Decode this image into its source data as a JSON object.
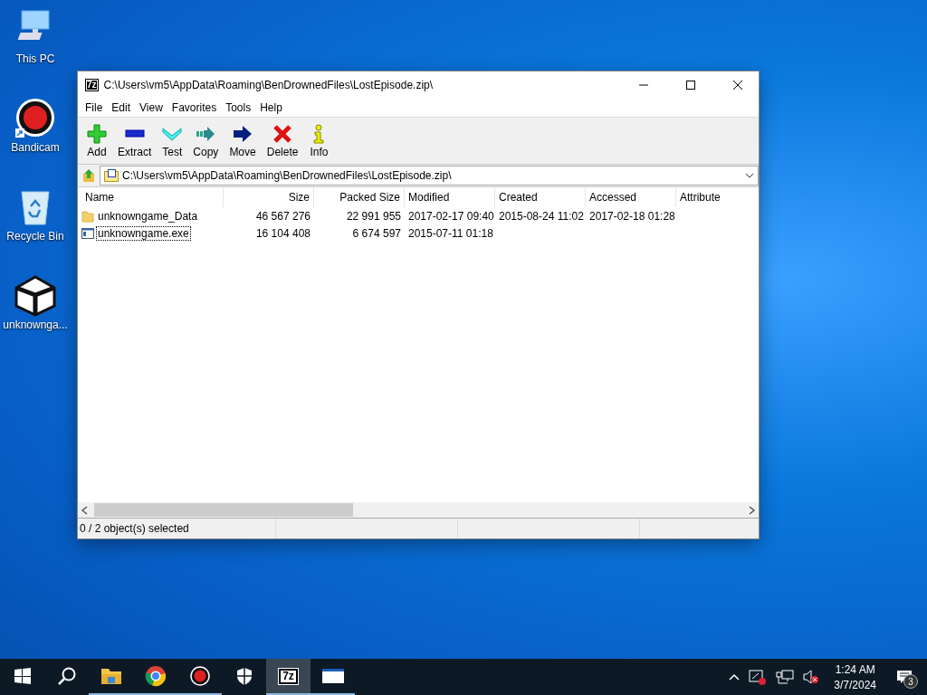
{
  "desktop_icons": [
    {
      "label": "This PC"
    },
    {
      "label": "Bandicam"
    },
    {
      "label": "Recycle Bin"
    },
    {
      "label": "unknownga..."
    }
  ],
  "window": {
    "app_icon_label": "7z",
    "title": "C:\\Users\\vm5\\AppData\\Roaming\\BenDrownedFiles\\LostEpisode.zip\\",
    "menu": [
      "File",
      "Edit",
      "View",
      "Favorites",
      "Tools",
      "Help"
    ],
    "toolbar": [
      {
        "label": "Add"
      },
      {
        "label": "Extract"
      },
      {
        "label": "Test"
      },
      {
        "label": "Copy"
      },
      {
        "label": "Move"
      },
      {
        "label": "Delete"
      },
      {
        "label": "Info"
      }
    ],
    "address": "C:\\Users\\vm5\\AppData\\Roaming\\BenDrownedFiles\\LostEpisode.zip\\",
    "columns": [
      "Name",
      "Size",
      "Packed Size",
      "Modified",
      "Created",
      "Accessed",
      "Attribute"
    ],
    "rows": [
      {
        "kind": "folder",
        "focused": false,
        "cells": [
          "unknowngame_Data",
          "46 567 276",
          "22 991 955",
          "2017-02-17 09:40",
          "2015-08-24 11:02",
          "2017-02-18 01:28"
        ]
      },
      {
        "kind": "exe",
        "focused": true,
        "cells": [
          "unknowngame.exe",
          "16 104 408",
          "6 674 597",
          "2015-07-11 01:18",
          "",
          ""
        ]
      }
    ],
    "status": "0 / 2 object(s) selected"
  },
  "taskbar": {
    "items": [
      {
        "running": false,
        "active": false
      },
      {
        "running": false,
        "active": false
      },
      {
        "running": true,
        "active": false
      },
      {
        "running": true,
        "active": false
      },
      {
        "running": true,
        "active": false
      },
      {
        "running": false,
        "active": false
      },
      {
        "running": true,
        "active": true,
        "label": "7z"
      },
      {
        "running": true,
        "active": false
      }
    ],
    "time": "1:24 AM",
    "date": "3/7/2024",
    "notifications": "3"
  }
}
